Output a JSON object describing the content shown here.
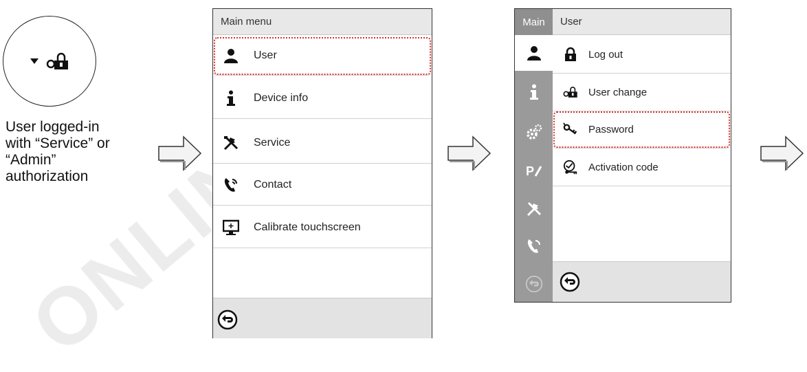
{
  "watermark": "ONLINGO",
  "caption": {
    "lines": [
      "User logged-in",
      "with “Service” or",
      "“Admin”",
      "authorization"
    ]
  },
  "icons": {
    "status_indicator": [
      "dropdown-triangle-icon",
      "user-lock-icon"
    ],
    "main_menu": [
      "user-icon",
      "info-icon",
      "tools-icon",
      "phone-icon",
      "monitor-icon"
    ],
    "user_menu": [
      "padlock-icon",
      "user-lock-icon",
      "key-icon",
      "activation-icon"
    ],
    "sidebar": [
      "user-icon",
      "info-icon",
      "gears-icon",
      "program-icon",
      "tools-icon",
      "phone-icon",
      "back-icon"
    ]
  },
  "screen1": {
    "header": "Main menu",
    "items": [
      {
        "label": "User",
        "highlighted": true
      },
      {
        "label": "Device info"
      },
      {
        "label": "Service"
      },
      {
        "label": "Contact"
      },
      {
        "label": "Calibrate touchscreen"
      }
    ]
  },
  "screen2": {
    "sidebar_label": "Main",
    "header": "User",
    "items": [
      {
        "label": "Log out"
      },
      {
        "label": "User change"
      },
      {
        "label": "Password",
        "highlighted": true
      },
      {
        "label": "Activation code"
      }
    ]
  },
  "colors": {
    "highlight": "#d9302c",
    "sidebar": "#9a9a9a",
    "header_bg": "#e8e8e8"
  }
}
